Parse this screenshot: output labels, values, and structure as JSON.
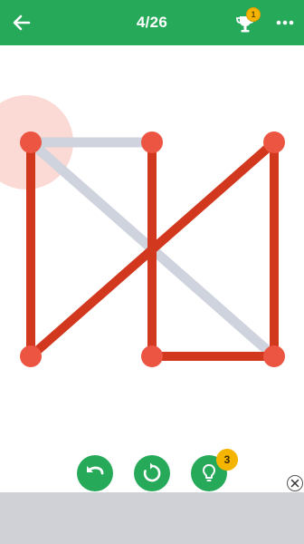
{
  "header": {
    "level_counter": "4/26",
    "trophy_badge": "1",
    "icons": [
      "arrow-left-icon",
      "trophy-icon",
      "more-horiz-icon"
    ]
  },
  "puzzle": {
    "colors": {
      "drawn_line": "#d2381e",
      "remaining_line": "#cfd3dd",
      "node": "#ec5542",
      "cursor_halo": "#fbd9d4"
    },
    "nodes": [
      {
        "id": "n1",
        "col": 0,
        "row": 0
      },
      {
        "id": "n2",
        "col": 1,
        "row": 0
      },
      {
        "id": "n3",
        "col": 2,
        "row": 0
      },
      {
        "id": "n4",
        "col": 0,
        "row": 1
      },
      {
        "id": "n5",
        "col": 1,
        "row": 1
      },
      {
        "id": "n6",
        "col": 2,
        "row": 1
      }
    ],
    "edges": [
      {
        "from": "n1",
        "to": "n2",
        "drawn": false
      },
      {
        "from": "n1",
        "to": "n6",
        "drawn": false
      },
      {
        "from": "n1",
        "to": "n4",
        "drawn": true
      },
      {
        "from": "n4",
        "to": "n3",
        "drawn": true
      },
      {
        "from": "n3",
        "to": "n6",
        "drawn": true
      },
      {
        "from": "n6",
        "to": "n5",
        "drawn": true
      },
      {
        "from": "n5",
        "to": "n2",
        "drawn": true
      }
    ],
    "active_node": "n1"
  },
  "controls": {
    "hint_count": "3",
    "icons": [
      "undo-icon",
      "restart-icon",
      "lightbulb-icon",
      "close-icon"
    ]
  }
}
